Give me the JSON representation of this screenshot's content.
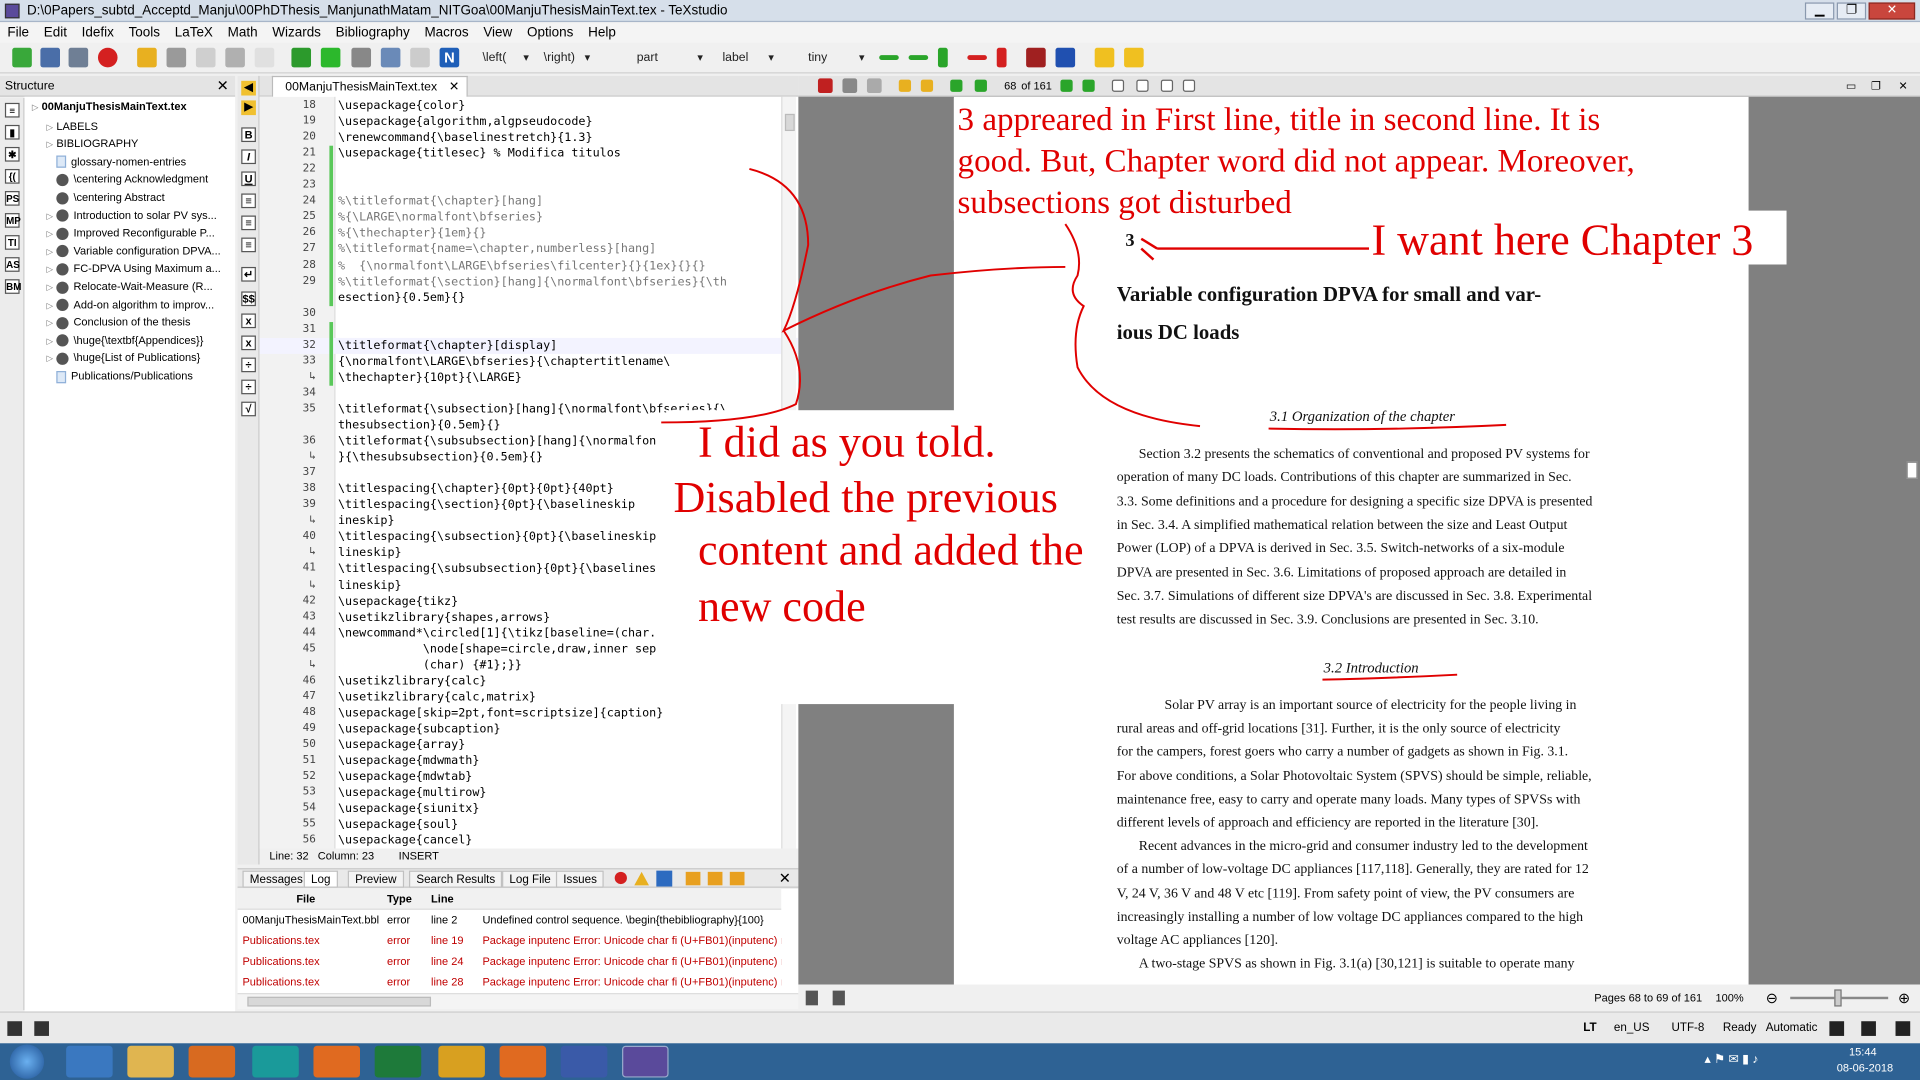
{
  "window": {
    "title": "D:\\0Papers_subtd_Acceptd_Manju\\00PhDThesis_ManjunathMatam_NITGoa\\00ManjuThesisMainText.tex - TeXstudio"
  },
  "menu": [
    "File",
    "Edit",
    "Idefix",
    "Tools",
    "LaTeX",
    "Math",
    "Wizards",
    "Bibliography",
    "Macros",
    "View",
    "Options",
    "Help"
  ],
  "toolbar": {
    "left": "\\left(",
    "right": "\\right)",
    "part": "part",
    "label": "label",
    "size": "tiny"
  },
  "structure": {
    "header": "Structure",
    "items": [
      {
        "label": "00ManjuThesisMainText.tex",
        "bold": true,
        "depth": 0,
        "icon": "file-icon"
      },
      {
        "label": "LABELS",
        "depth": 1,
        "icon": "none"
      },
      {
        "label": "BIBLIOGRAPHY",
        "depth": 1,
        "icon": "none"
      },
      {
        "label": "glossary-nomen-entries",
        "depth": 1,
        "icon": "doc-icon"
      },
      {
        "label": "\\centering Acknowledgment",
        "depth": 1,
        "icon": "chapter-icon"
      },
      {
        "label": "\\centering Abstract",
        "depth": 1,
        "icon": "chapter-icon"
      },
      {
        "label": "Introduction to solar PV sys...",
        "depth": 1,
        "icon": "chapter-icon"
      },
      {
        "label": "Improved Reconfigurable P...",
        "depth": 1,
        "icon": "chapter-icon"
      },
      {
        "label": "Variable configuration DPVA...",
        "depth": 1,
        "icon": "chapter-icon"
      },
      {
        "label": "FC-DPVA Using Maximum a...",
        "depth": 1,
        "icon": "chapter-icon"
      },
      {
        "label": "Relocate-Wait-Measure (R...",
        "depth": 1,
        "icon": "chapter-icon"
      },
      {
        "label": "Add-on algorithm to improv...",
        "depth": 1,
        "icon": "chapter-icon"
      },
      {
        "label": "Conclusion of the thesis",
        "depth": 1,
        "icon": "chapter-icon"
      },
      {
        "label": "\\huge{\\textbf{Appendices}}",
        "depth": 1,
        "icon": "chapter-icon"
      },
      {
        "label": "\\huge{List of Publications}",
        "depth": 1,
        "icon": "chapter-icon"
      },
      {
        "label": "Publications/Publications",
        "depth": 1,
        "icon": "doc-icon"
      }
    ]
  },
  "editor": {
    "tab": "00ManjuThesisMainText.tex",
    "lines": [
      {
        "n": "18",
        "code": "\\usepackage{color}"
      },
      {
        "n": "19",
        "code": "\\usepackage{algorithm,algpseudocode}"
      },
      {
        "n": "20",
        "code": "\\renewcommand{\\baselinestretch}{1.3}"
      },
      {
        "n": "21",
        "code": "\\usepackage{titlesec} % Modifica titulos"
      },
      {
        "n": "22",
        "code": ""
      },
      {
        "n": "23",
        "code": ""
      },
      {
        "n": "24",
        "code": "%\\titleformat{\\chapter}[hang]"
      },
      {
        "n": "25",
        "code": "%{\\LARGE\\normalfont\\bfseries}"
      },
      {
        "n": "26",
        "code": "%{\\thechapter}{1em}{}"
      },
      {
        "n": "27",
        "code": "%\\titleformat{name=\\chapter,numberless}[hang]"
      },
      {
        "n": "28",
        "code": "%  {\\normalfont\\LARGE\\bfseries\\filcenter}{}{1ex}{}{}"
      },
      {
        "n": "29",
        "code": "%\\titleformat{\\section}[hang]{\\normalfont\\bfseries}{\\th"
      },
      {
        "n": "",
        "code": "esection}{0.5em}{}"
      },
      {
        "n": "30",
        "code": ""
      },
      {
        "n": "31",
        "code": ""
      },
      {
        "n": "32",
        "code": "\\titleformat{\\chapter}[display]"
      },
      {
        "n": "33",
        "code": "{\\normalfont\\LARGE\\bfseries}{\\chaptertitlename\\"
      },
      {
        "n": "↳",
        "code": "\\thechapter}{10pt}{\\LARGE}"
      },
      {
        "n": "34",
        "code": ""
      },
      {
        "n": "35",
        "code": "\\titleformat{\\subsection}[hang]{\\normalfont\\bfseries}{\\"
      },
      {
        "n": "",
        "code": "thesubsection}{0.5em}{}"
      },
      {
        "n": "36",
        "code": "\\titleformat{\\subsubsection}[hang]{\\normalfon"
      },
      {
        "n": "↳",
        "code": "}{\\thesubsubsection}{0.5em}{}"
      },
      {
        "n": "37",
        "code": ""
      },
      {
        "n": "38",
        "code": "\\titlespacing{\\chapter}{0pt}{0pt}{40pt}"
      },
      {
        "n": "39",
        "code": "\\titlespacing{\\section}{0pt}{\\baselineskip"
      },
      {
        "n": "↳",
        "code": "ineskip}"
      },
      {
        "n": "40",
        "code": "\\titlespacing{\\subsection}{0pt}{\\baselineskip"
      },
      {
        "n": "↳",
        "code": "lineskip}"
      },
      {
        "n": "41",
        "code": "\\titlespacing{\\subsubsection}{0pt}{\\baselines"
      },
      {
        "n": "↳",
        "code": "lineskip}"
      },
      {
        "n": "42",
        "code": "\\usepackage{tikz}"
      },
      {
        "n": "43",
        "code": "\\usetikzlibrary{shapes,arrows}"
      },
      {
        "n": "44",
        "code": "\\newcommand*\\circled[1]{\\tikz[baseline=(char."
      },
      {
        "n": "45",
        "code": "            \\node[shape=circle,draw,inner sep"
      },
      {
        "n": "↳",
        "code": "            (char) {#1};}}"
      },
      {
        "n": "46",
        "code": "\\usetikzlibrary{calc}"
      },
      {
        "n": "47",
        "code": "\\usetikzlibrary{calc,matrix}"
      },
      {
        "n": "48",
        "code": "\\usepackage[skip=2pt,font=scriptsize]{caption}"
      },
      {
        "n": "49",
        "code": "\\usepackage{subcaption}"
      },
      {
        "n": "50",
        "code": "\\usepackage{array}"
      },
      {
        "n": "51",
        "code": "\\usepackage{mdwmath}"
      },
      {
        "n": "52",
        "code": "\\usepackage{mdwtab}"
      },
      {
        "n": "53",
        "code": "\\usepackage{multirow}"
      },
      {
        "n": "54",
        "code": "\\usepackage{siunitx}"
      },
      {
        "n": "55",
        "code": "\\usepackage{soul}"
      },
      {
        "n": "56",
        "code": "\\usepackage{cancel}"
      }
    ],
    "status": "Line: 32   Column: 23        INSERT"
  },
  "messages": {
    "tabs": [
      "Messages",
      "Log",
      "Preview",
      "Search Results",
      "Log File",
      "Issues"
    ],
    "headers": [
      "File",
      "Type",
      "Line"
    ],
    "rows": [
      {
        "file": "00ManjuThesisMainText.bbl",
        "type": "error",
        "line": "line 2",
        "msg": "Undefined control sequence. \\begin{thebibliography}{100}",
        "red": false
      },
      {
        "file": "Publications.tex",
        "type": "error",
        "line": "line 19",
        "msg": "Package inputenc Error: Unicode char fi (U+FB01)(inputenc) n",
        "red": true
      },
      {
        "file": "Publications.tex",
        "type": "error",
        "line": "line 24",
        "msg": "Package inputenc Error: Unicode char fi (U+FB01)(inputenc) n",
        "red": true
      },
      {
        "file": "Publications.tex",
        "type": "error",
        "line": "line 28",
        "msg": "Package inputenc Error: Unicode char fi (U+FB01)(inputenc) n",
        "red": true
      }
    ]
  },
  "pdf": {
    "page": "68",
    "of": "of 161",
    "chapter_num": "3",
    "chapter_title_1": "Variable configuration DPVA for small and var-",
    "chapter_title_2": "ious DC loads",
    "sec1": "3.1   Organization of the chapter",
    "para1": [
      "Section 3.2 presents the schematics of conventional and proposed PV systems for",
      "operation of many DC loads.  Contributions of this chapter are summarized in Sec.",
      "3.3. Some definitions and a procedure for designing a specific size DPVA is presented",
      "in Sec. 3.4.  A simplified mathematical relation between the size and Least Output",
      "Power (LOP) of a DPVA is derived in Sec.  3.5.  Switch-networks of a six-module",
      "DPVA are presented in Sec.  3.6.  Limitations of proposed approach are detailed in",
      "Sec. 3.7. Simulations of different size DPVA's are discussed in Sec. 3.8. Experimental",
      "test results are discussed in Sec. 3.9.  Conclusions are presented in Sec. 3.10."
    ],
    "sec2": "3.2   Introduction",
    "para2": [
      "Solar PV array is an important source of electricity for the people living in",
      "rural areas and off-grid locations [31].  Further, it is the only source of electricity",
      "for the campers, forest goers who carry a number of gadgets as shown in Fig. 3.1.",
      "For above conditions, a Solar Photovoltaic System (SPVS) should be simple, reliable,",
      "maintenance free, easy to carry and operate many loads.  Many types of SPVSs with",
      "different levels of approach and efficiency are reported in the literature [30].",
      "Recent advances in the micro-grid and consumer industry led to the development",
      "of a number of low-voltage DC appliances [117,118].  Generally, they are rated for 12",
      "V, 24 V, 36 V and 48 V etc [119].  From safety point of view, the PV consumers are",
      "increasingly installing a number of low voltage DC appliances compared to the high",
      "voltage AC appliances [120].",
      "A two-stage SPVS as shown in Fig. 3.1(a) [30,121] is suitable to operate many"
    ],
    "pages_info": "Pages 68 to 69 of 161",
    "zoom": "100%"
  },
  "appstatus": {
    "lang": "en_US",
    "enc": "UTF-8",
    "ready": "Ready",
    "auto": "Automatic"
  },
  "clock": {
    "time": "15:44",
    "date": "08-06-2018"
  },
  "annotations": {
    "a1_l1": "3 appreared in First line, title in second line. It is",
    "a1_l2": "good. But, Chapter word did not appear. Moreover,",
    "a1_l3": "subsections got disturbed",
    "a2": "I want here Chapter 3",
    "a3_l1": "I  did   as you told.",
    "a3_l2": "Disabled the previous",
    "a3_l3": "content and added the",
    "a3_l4": "new code"
  },
  "colors": {
    "annotation": "#e00000",
    "gutter_green": "#5ac85a",
    "taskbar": "#2e6294"
  }
}
